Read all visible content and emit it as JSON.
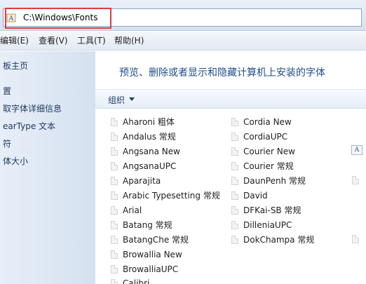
{
  "address": {
    "path": "C:\\Windows\\Fonts",
    "folder_icon": "fonts-folder-icon",
    "highlight_color": "#e23b3b"
  },
  "menu": [
    "编辑(E)",
    "查看(V)",
    "工具(T)",
    "帮助(H)"
  ],
  "nav": {
    "items": [
      "板主页",
      "置",
      "取字体详细信息",
      "earType 文本",
      "符",
      "体大小"
    ]
  },
  "content": {
    "heading": "预览、删除或者显示和隐藏计算机上安装的字体",
    "organize_label": "组织",
    "fonts_col1": [
      "Aharoni 粗体",
      "Andalus 常规",
      "Angsana New",
      "AngsanaUPC",
      "Aparajita",
      "Arabic Typesetting 常规",
      "Arial",
      "Batang 常规",
      "BatangChe 常规",
      "Browallia New",
      "BrowalliaUPC",
      "Calibri"
    ],
    "fonts_col2": [
      "Cordia New",
      "CordiaUPC",
      "Courier New",
      "Courier 常规",
      "DaunPenh 常规",
      "David",
      "DFKai-SB 常规",
      "DilleniaUPC",
      "DokChampa 常规"
    ],
    "font_icon_glyph": "A"
  },
  "colors": {
    "heading": "#1f4e8c",
    "nav_text": "#1e3c64"
  }
}
